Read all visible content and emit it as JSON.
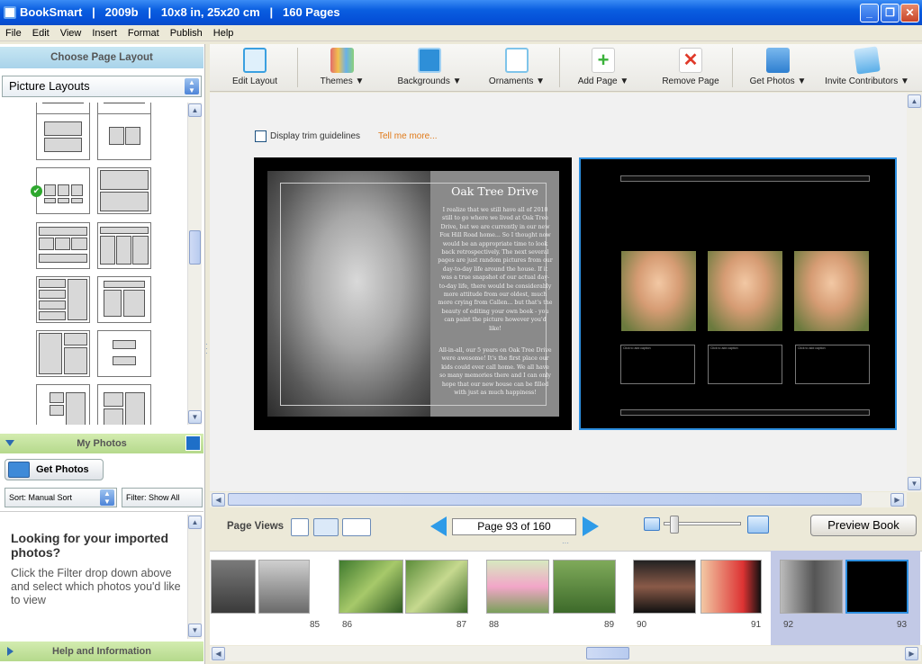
{
  "window": {
    "title": "BookSmart   |   2009b   |   10x8 in, 25x20 cm   |   160 Pages"
  },
  "menu": [
    "File",
    "Edit",
    "View",
    "Insert",
    "Format",
    "Publish",
    "Help"
  ],
  "left_panel": {
    "header": "Choose Page Layout",
    "layout_select": "Picture Layouts",
    "my_photos": "My Photos",
    "get_photos": "Get Photos",
    "sort": "Sort:  Manual Sort",
    "filter": "Filter: Show All",
    "help_title": "Looking for your imported photos?",
    "help_body": "Click the Filter drop down above and select which photos you'd like to view",
    "help_header": "Help and Information"
  },
  "toolbar": [
    {
      "label": "Edit Layout",
      "icon": "edit-layout-icon",
      "color": "#3aa0e0"
    },
    {
      "label": "Themes ▼",
      "icon": "themes-icon",
      "color": "#5b9ad8"
    },
    {
      "label": "Backgrounds ▼",
      "icon": "backgrounds-icon",
      "color": "#2e8fd8"
    },
    {
      "label": "Ornaments ▼",
      "icon": "ornaments-icon",
      "color": "#7fc4ea"
    },
    {
      "label": "Add Page ▼",
      "icon": "add-page-icon",
      "color": "#4cb84c"
    },
    {
      "label": "Remove Page",
      "icon": "remove-page-icon",
      "color": "#e03a2a"
    },
    {
      "label": "Get Photos ▼",
      "icon": "get-photos-icon",
      "color": "#2e7fd0"
    },
    {
      "label": "Invite Contributors ▼",
      "icon": "invite-contributors-icon",
      "color": "#5aaee8"
    }
  ],
  "canvas": {
    "trim_label": "Display trim guidelines",
    "tell_me": "Tell me more...",
    "story_title": "Oak Tree Drive",
    "story_p1": "I realize that we still have all of 2010 still to go where we lived at Oak Tree Drive, but we are currently in our new Fox Hill Road home... So I thought now would be an appropriate time to look back retrospectively.  The next several pages are just random pictures from our day-to-day life around the house.  If it was a true snapshot of our actual day-to-day life, there would be considerably more attitude from our oldest, much more crying from Callen... but that's the beauty of editing your own book - you can paint the picture however you'd like!",
    "story_p2": "All-in-all, our 5 years on Oak Tree Drive were awesome!  It's the first place our kids could ever call home.  We all have so many memories there and I can only hope that our new house can be filled with just as much happiness!",
    "caption_placeholder": "Click to add caption"
  },
  "page_views": {
    "label": "Page Views",
    "indicator": "Page 93 of 160",
    "preview": "Preview Book"
  },
  "filmstrip": {
    "pages": [
      "85",
      "86",
      "87",
      "88",
      "89",
      "90",
      "91",
      "92",
      "93"
    ]
  },
  "colors": {
    "accent_blue": "#2e9be8",
    "panel_blue": "#c7e6f3",
    "panel_green": "#c4e29e",
    "selected": "#c2c9e6"
  }
}
